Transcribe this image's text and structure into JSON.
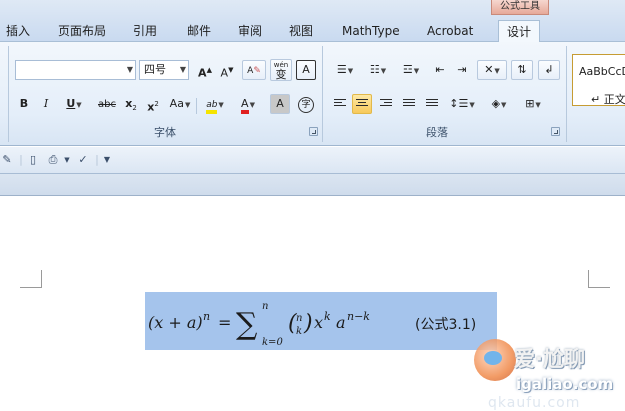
{
  "tabs": {
    "context_label": "公式工具",
    "items": [
      {
        "label": "插入"
      },
      {
        "label": "页面布局"
      },
      {
        "label": "引用"
      },
      {
        "label": "邮件"
      },
      {
        "label": "审阅"
      },
      {
        "label": "视图"
      },
      {
        "label": "MathType"
      },
      {
        "label": "Acrobat"
      },
      {
        "label": "设计"
      }
    ],
    "active": "设计"
  },
  "font_group": {
    "label": "字体",
    "font_name_value": "",
    "font_size_value": "四号",
    "grow": "A",
    "shrink": "A",
    "clear_format": "A",
    "phonetic": "wén",
    "phonetic_char": "变",
    "char_border": "A",
    "bold": "B",
    "italic": "I",
    "underline": "U",
    "strike": "abc",
    "subscript": "x",
    "superscript": "x",
    "change_case": "Aa",
    "highlight": "ab",
    "font_color": "A",
    "char_shading": "A",
    "enclose": "字"
  },
  "paragraph_group": {
    "label": "段落"
  },
  "styles_group": {
    "preview": "AaBbCcDc",
    "name": "↵ 正文"
  },
  "equation": {
    "number": "(公式3.1)"
  },
  "watermark": {
    "main": "爱·尬聊",
    "url": "igaliao.com",
    "bottom": "qkaufu.com"
  },
  "colors": {
    "accent": "#a5c4ec",
    "ribbon": "#e4eef9",
    "font_red": "#e02020",
    "highlight_yellow": "#f5e400"
  }
}
